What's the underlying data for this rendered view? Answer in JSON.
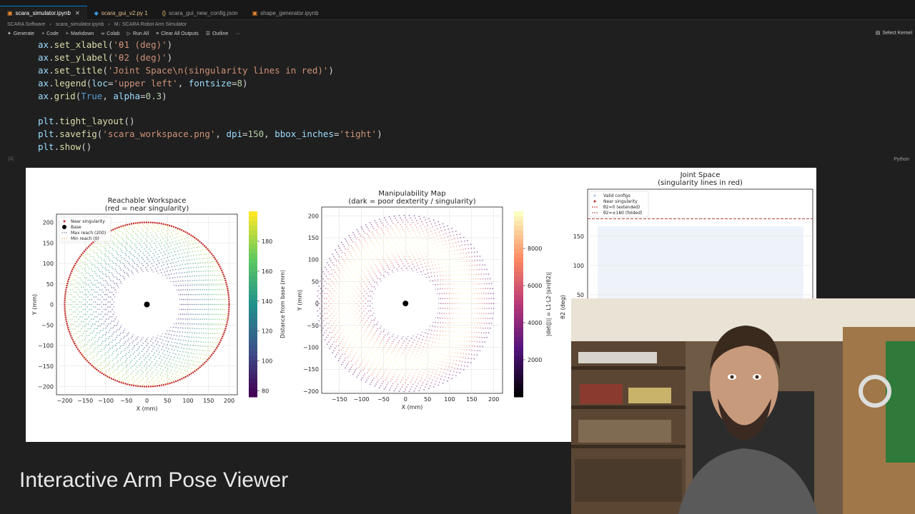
{
  "tabs": [
    {
      "label": "scara_simulator.ipynb",
      "active": true,
      "icon": "notebook-icon"
    },
    {
      "label": "scara_gui_v2.py 1",
      "modified": true,
      "icon": "python-icon"
    },
    {
      "label": "scara_gui_new_config.json",
      "icon": "json-icon"
    },
    {
      "label": "shape_generator.ipynb",
      "icon": "notebook-icon"
    }
  ],
  "breadcrumb": [
    "SCARA Software",
    "scara_simulator.ipynb",
    "M↓ SCARA Robot Arm Simulator"
  ],
  "toolbar": {
    "generate": "Generate",
    "code": "Code",
    "markdown": "Markdown",
    "colab": "Colab",
    "run_all": "Run All",
    "clear_outputs": "Clear All Outputs",
    "outline": "Outline",
    "more": "···",
    "kernel": "Select Kernel"
  },
  "language": "Python",
  "cell_marker": "[1]",
  "code_lines": [
    {
      "parts": [
        [
          "var",
          "ax"
        ],
        [
          "",
          "."
        ],
        [
          "fn",
          "set_xlabel"
        ],
        [
          "",
          "("
        ],
        [
          "str",
          "'θ1 (deg)'"
        ],
        [
          "",
          ")"
        ]
      ]
    },
    {
      "parts": [
        [
          "var",
          "ax"
        ],
        [
          "",
          "."
        ],
        [
          "fn",
          "set_ylabel"
        ],
        [
          "",
          "("
        ],
        [
          "str",
          "'θ2 (deg)'"
        ],
        [
          "",
          ")"
        ]
      ]
    },
    {
      "parts": [
        [
          "var",
          "ax"
        ],
        [
          "",
          "."
        ],
        [
          "fn",
          "set_title"
        ],
        [
          "",
          "("
        ],
        [
          "str",
          "'Joint Space\\n(singularity lines in red)'"
        ],
        [
          "",
          ")"
        ]
      ]
    },
    {
      "parts": [
        [
          "var",
          "ax"
        ],
        [
          "",
          "."
        ],
        [
          "fn",
          "legend"
        ],
        [
          "",
          "("
        ],
        [
          "prm",
          "loc"
        ],
        [
          "",
          "="
        ],
        [
          "str",
          "'upper left'"
        ],
        [
          "",
          ", "
        ],
        [
          "prm",
          "fontsize"
        ],
        [
          "",
          "="
        ],
        [
          "num",
          "8"
        ],
        [
          "",
          ")"
        ]
      ]
    },
    {
      "parts": [
        [
          "var",
          "ax"
        ],
        [
          "",
          "."
        ],
        [
          "fn",
          "grid"
        ],
        [
          "",
          "("
        ],
        [
          "kw",
          "True"
        ],
        [
          "",
          ", "
        ],
        [
          "prm",
          "alpha"
        ],
        [
          "",
          "="
        ],
        [
          "num",
          "0.3"
        ],
        [
          "",
          ")"
        ]
      ]
    },
    {
      "parts": []
    },
    {
      "parts": [
        [
          "var",
          "plt"
        ],
        [
          "",
          "."
        ],
        [
          "fn",
          "tight_layout"
        ],
        [
          "",
          "()"
        ]
      ]
    },
    {
      "parts": [
        [
          "var",
          "plt"
        ],
        [
          "",
          "."
        ],
        [
          "fn",
          "savefig"
        ],
        [
          "",
          "("
        ],
        [
          "str",
          "'scara_workspace.png'"
        ],
        [
          "",
          ", "
        ],
        [
          "prm",
          "dpi"
        ],
        [
          "",
          "="
        ],
        [
          "num",
          "150"
        ],
        [
          "",
          ", "
        ],
        [
          "prm",
          "bbox_inches"
        ],
        [
          "",
          "="
        ],
        [
          "str",
          "'tight'"
        ],
        [
          "",
          ")"
        ]
      ]
    },
    {
      "parts": [
        [
          "var",
          "plt"
        ],
        [
          "",
          "."
        ],
        [
          "fn",
          "show"
        ],
        [
          "",
          "()"
        ]
      ]
    }
  ],
  "caption": "Interactive Arm Pose Viewer",
  "chart_data": [
    {
      "type": "scatter",
      "title": "Reachable Workspace\n(red = near singularity)",
      "xlabel": "X (mm)",
      "ylabel": "Y (mm)",
      "xlim": [
        -220,
        220
      ],
      "ylim": [
        -220,
        220
      ],
      "xticks": [
        -200,
        -150,
        -100,
        -50,
        0,
        50,
        100,
        150,
        200
      ],
      "yticks": [
        -200,
        -150,
        -100,
        -50,
        0,
        50,
        100,
        150,
        200
      ],
      "max_reach": 200,
      "min_reach": 80,
      "base": [
        0,
        0
      ],
      "legend": [
        "Near singularity",
        "Base",
        "Max reach (200)",
        "Min reach (0)"
      ],
      "legend_loc": "upper left",
      "colorbar": {
        "label": "Distance from base (mm)",
        "ticks": [
          80,
          100,
          120,
          140,
          160,
          180
        ],
        "range": [
          76,
          200
        ],
        "cmap": "viridis"
      }
    },
    {
      "type": "scatter",
      "title": "Manipulability Map\n(dark = poor dexterity / singularity)",
      "xlabel": "X (mm)",
      "ylabel": "Y (mm)",
      "xlim": [
        -190,
        220
      ],
      "ylim": [
        -205,
        220
      ],
      "xticks": [
        -150,
        -100,
        -50,
        0,
        50,
        100,
        150,
        200
      ],
      "yticks": [
        -200,
        -150,
        -100,
        -50,
        0,
        50,
        100,
        150,
        200
      ],
      "max_reach": 200,
      "min_reach": 75,
      "base": [
        0,
        0
      ],
      "colorbar": {
        "label": "|det(J)| = L1·L2·|sin(θ2)|",
        "ticks": [
          2000,
          4000,
          6000,
          8000
        ],
        "range": [
          0,
          10000
        ],
        "cmap": "magma"
      }
    },
    {
      "type": "scatter",
      "title": "Joint Space\n(singularity lines in red)",
      "xlabel": "",
      "ylabel": "θ2 (deg)",
      "yticks": [
        50,
        100,
        150
      ],
      "ylim_visible": [
        32,
        190
      ],
      "legend": [
        "Valid configs",
        "Near singularity",
        "θ2=0 (extended)",
        "θ2=±180 (folded)"
      ],
      "legend_loc": "upper left",
      "singularity_line": 180
    }
  ]
}
